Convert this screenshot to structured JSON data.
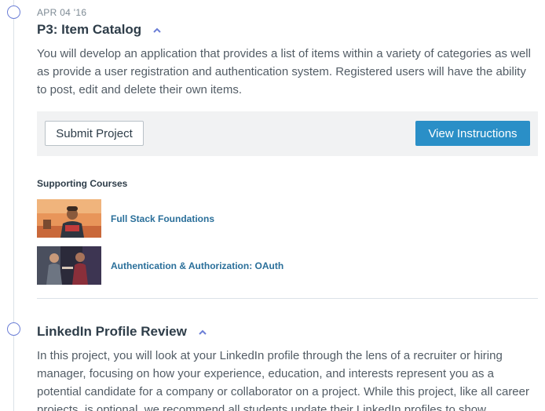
{
  "projects": [
    {
      "date": "APR 04 '16",
      "title": "P3: Item Catalog",
      "description": "You will develop an application that provides a list of items within a variety of categories as well as provide a user registration and authentication system. Registered users will have the ability to post, edit and delete their own items.",
      "submit_label": "Submit Project",
      "instructions_label": "View Instructions",
      "supporting_heading": "Supporting Courses",
      "courses": [
        {
          "title": "Full Stack Foundations"
        },
        {
          "title": "Authentication & Authorization: OAuth"
        }
      ]
    },
    {
      "title": "LinkedIn Profile Review",
      "description": "In this project, you will look at your LinkedIn profile through the lens of a recruiter or hiring manager, focusing on how your experience, education, and interests represent you as a potential candidate for a company or collaborator on a project. While this project, like all career projects, is optional, we recommend all students update their LinkedIn profiles to show"
    }
  ],
  "colors": {
    "accent": "#2a8fc7",
    "timeline_dot": "#6b7ed6",
    "link": "#2a6f9a",
    "title": "#2e3d49",
    "body_text": "#525c65",
    "action_bar_bg": "#f1f2f3"
  },
  "icons": {
    "timeline": "timeline-circle",
    "collapse": "chevron-up-icon"
  }
}
